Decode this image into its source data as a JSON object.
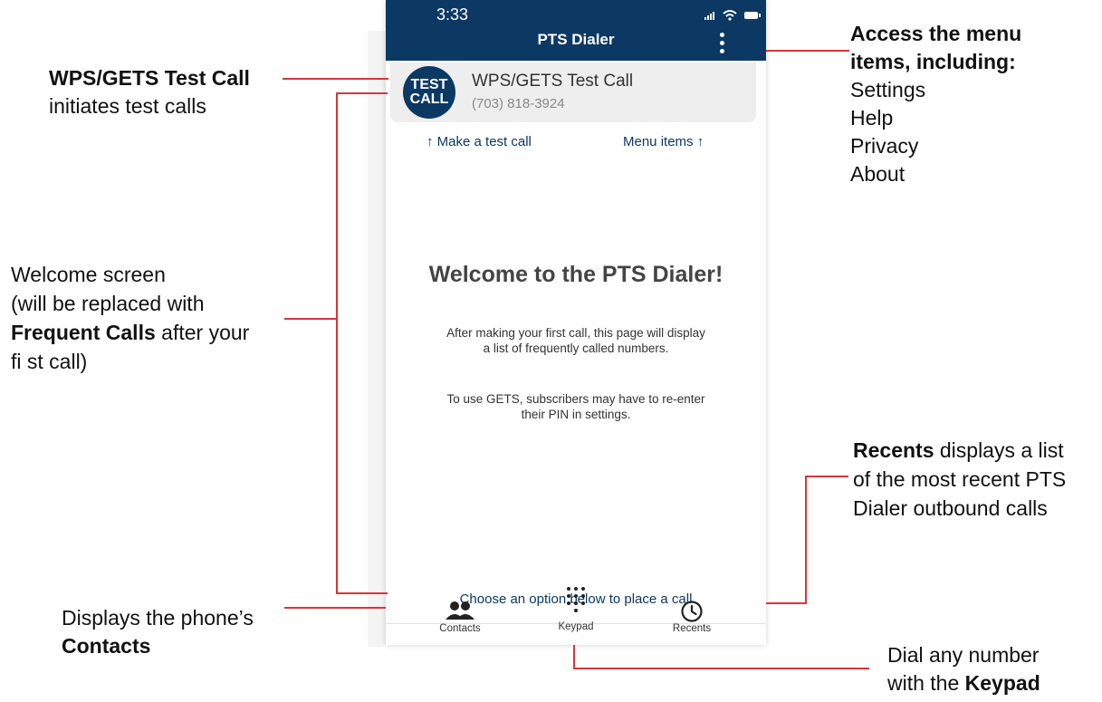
{
  "status_bar": {
    "time": "3:33"
  },
  "app": {
    "title": "PTS Dialer"
  },
  "test_call": {
    "avatar_line1": "TEST",
    "avatar_line2": "CALL",
    "name": "WPS/GETS Test Call",
    "number": "(703) 818-3924"
  },
  "hints": {
    "left": "↑  Make a test call",
    "right": "Menu items  ↑"
  },
  "welcome": {
    "title": "Welcome to the PTS Dialer!",
    "line1": "After making your first call, this page will display",
    "line2": "a list of frequently called numbers.",
    "line3": "To use GETS, subscribers may have to  re-enter",
    "line4": "their PIN in settings."
  },
  "choose_prompt": "Choose an option below to place a call",
  "tabs": [
    {
      "label": "Contacts",
      "icon": "contacts-icon"
    },
    {
      "label": "Keypad",
      "icon": "keypad-icon"
    },
    {
      "label": "Recents",
      "icon": "clock-icon"
    }
  ],
  "annotations": {
    "test_call_bold": "WPS/GETS Test Call",
    "test_call_desc": "initiates test calls",
    "menu_line1": "Access the menu",
    "menu_line2": "items, including:",
    "menu_items": [
      "Settings",
      "Help",
      "Privacy",
      "About"
    ],
    "welcome_line1": "Welcome screen",
    "welcome_line2": "(will be replaced with",
    "welcome_bold": "Frequent Calls",
    "welcome_line3_rest": " after your",
    "welcome_line4": "fi st call)",
    "recents_bold": "Recents",
    "recents_line1_rest": " displays a list",
    "recents_line2": "of the most recent PTS",
    "recents_line3": "Dialer outbound calls",
    "contacts_line1": "Displays the phone’s",
    "contacts_bold": "Contacts",
    "keypad_line1": "Dial any number",
    "keypad_line2_pre": "with the ",
    "keypad_bold": "Keypad"
  },
  "colors": {
    "brand_navy": "#0c3963",
    "annotation_red": "#d9353b"
  }
}
